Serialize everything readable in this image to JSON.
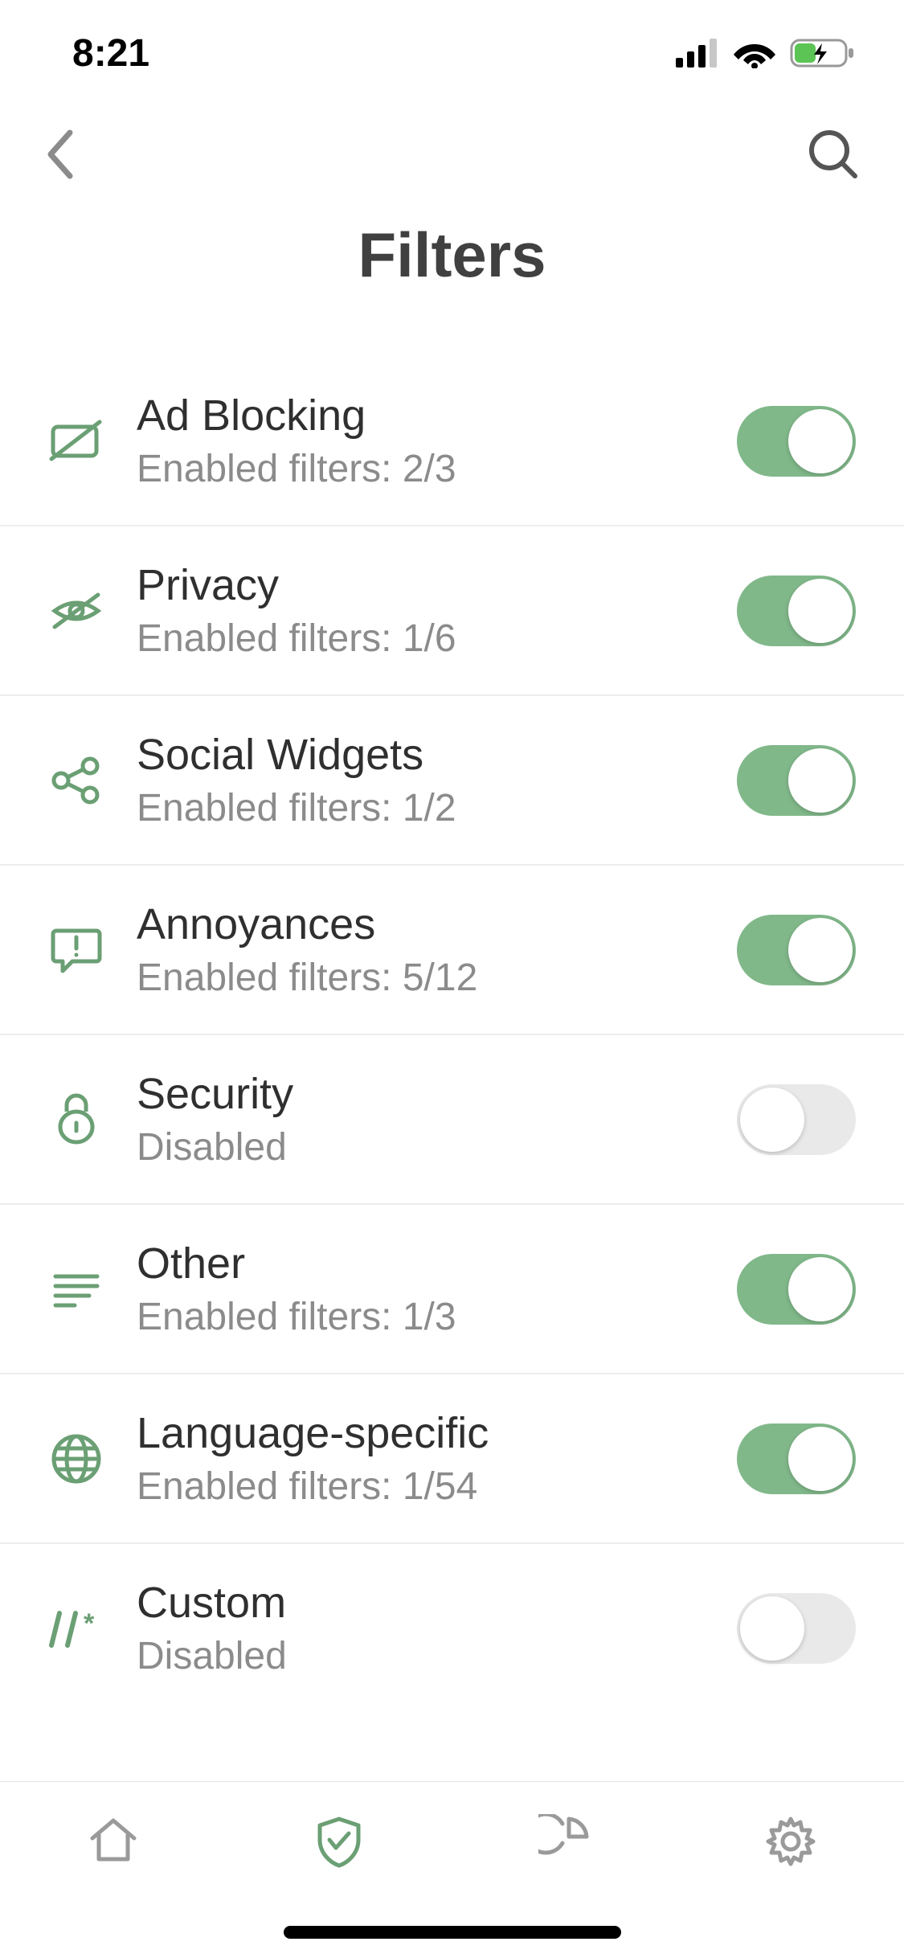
{
  "status": {
    "time": "8:21"
  },
  "header": {
    "title": "Filters"
  },
  "rows": [
    {
      "title": "Ad Blocking",
      "sub": "Enabled filters: 2/3",
      "on": true,
      "icon": "ad-block"
    },
    {
      "title": "Privacy",
      "sub": "Enabled filters: 1/6",
      "on": true,
      "icon": "privacy"
    },
    {
      "title": "Social Widgets",
      "sub": "Enabled filters: 1/2",
      "on": true,
      "icon": "social"
    },
    {
      "title": "Annoyances",
      "sub": "Enabled filters: 5/12",
      "on": true,
      "icon": "annoy"
    },
    {
      "title": "Security",
      "sub": "Disabled",
      "on": false,
      "icon": "security"
    },
    {
      "title": "Other",
      "sub": "Enabled filters: 1/3",
      "on": true,
      "icon": "other"
    },
    {
      "title": "Language-specific",
      "sub": "Enabled filters: 1/54",
      "on": true,
      "icon": "lang"
    },
    {
      "title": "Custom",
      "sub": "Disabled",
      "on": false,
      "icon": "custom"
    }
  ],
  "colors": {
    "accent": "#6b9f74",
    "iconGreen": "#6b9f74",
    "gray": "#9a9a9a"
  }
}
